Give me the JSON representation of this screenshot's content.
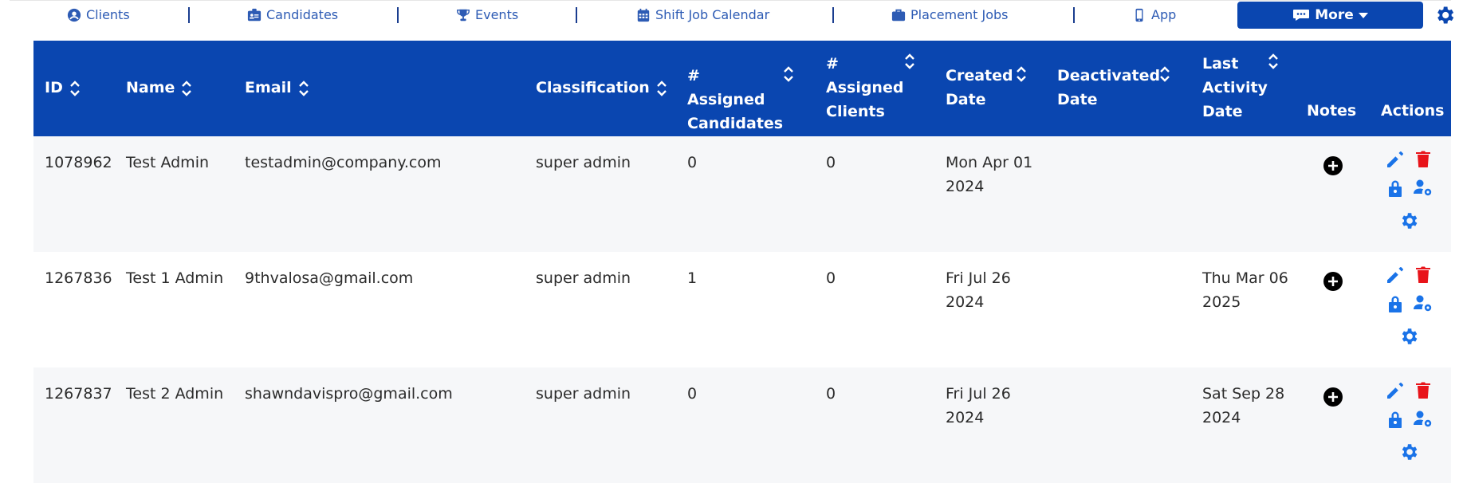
{
  "nav": {
    "items": [
      {
        "label": "Clients",
        "icon": "user-circle-icon"
      },
      {
        "label": "Candidates",
        "icon": "id-badge-icon"
      },
      {
        "label": "Events",
        "icon": "trophy-icon"
      },
      {
        "label": "Shift Job Calendar",
        "icon": "calendar-icon"
      },
      {
        "label": "Placement Jobs",
        "icon": "briefcase-icon"
      },
      {
        "label": "App",
        "icon": "mobile-icon"
      }
    ],
    "more_label": "More"
  },
  "colors": {
    "primary": "#0a46b0",
    "nav_text": "#2d5bb4",
    "icon_blue": "#1a73e8",
    "delete_red": "#e8141a"
  },
  "table": {
    "headers": {
      "id": "ID",
      "name": "Name",
      "email": "Email",
      "classification": "Classification",
      "assigned_candidates": "# Assigned Candidates",
      "assigned_clients": "# Assigned Clients",
      "created_date": "Created Date",
      "deactivated_date": "Deactivated Date",
      "last_activity_date": "Last Activity Date",
      "notes": "Notes",
      "actions": "Actions"
    },
    "rows": [
      {
        "id": "1078962",
        "name": "Test Admin",
        "email": "testadmin@company.com",
        "classification": "super admin",
        "assigned_candidates": "0",
        "assigned_clients": "0",
        "created_line1": "Mon Apr 01",
        "created_line2": "2024",
        "deactivated": "",
        "last_line1": "",
        "last_line2": ""
      },
      {
        "id": "1267836",
        "name": "Test 1 Admin",
        "email": "9thvalosa@gmail.com",
        "classification": "super admin",
        "assigned_candidates": "1",
        "assigned_clients": "0",
        "created_line1": "Fri Jul 26",
        "created_line2": "2024",
        "deactivated": "",
        "last_line1": "Thu Mar 06",
        "last_line2": "2025"
      },
      {
        "id": "1267837",
        "name": "Test 2 Admin",
        "email": "shawndavispro@gmail.com",
        "classification": "super admin",
        "assigned_candidates": "0",
        "assigned_clients": "0",
        "created_line1": "Fri Jul 26",
        "created_line2": "2024",
        "deactivated": "",
        "last_line1": "Sat Sep 28",
        "last_line2": "2024"
      }
    ]
  }
}
